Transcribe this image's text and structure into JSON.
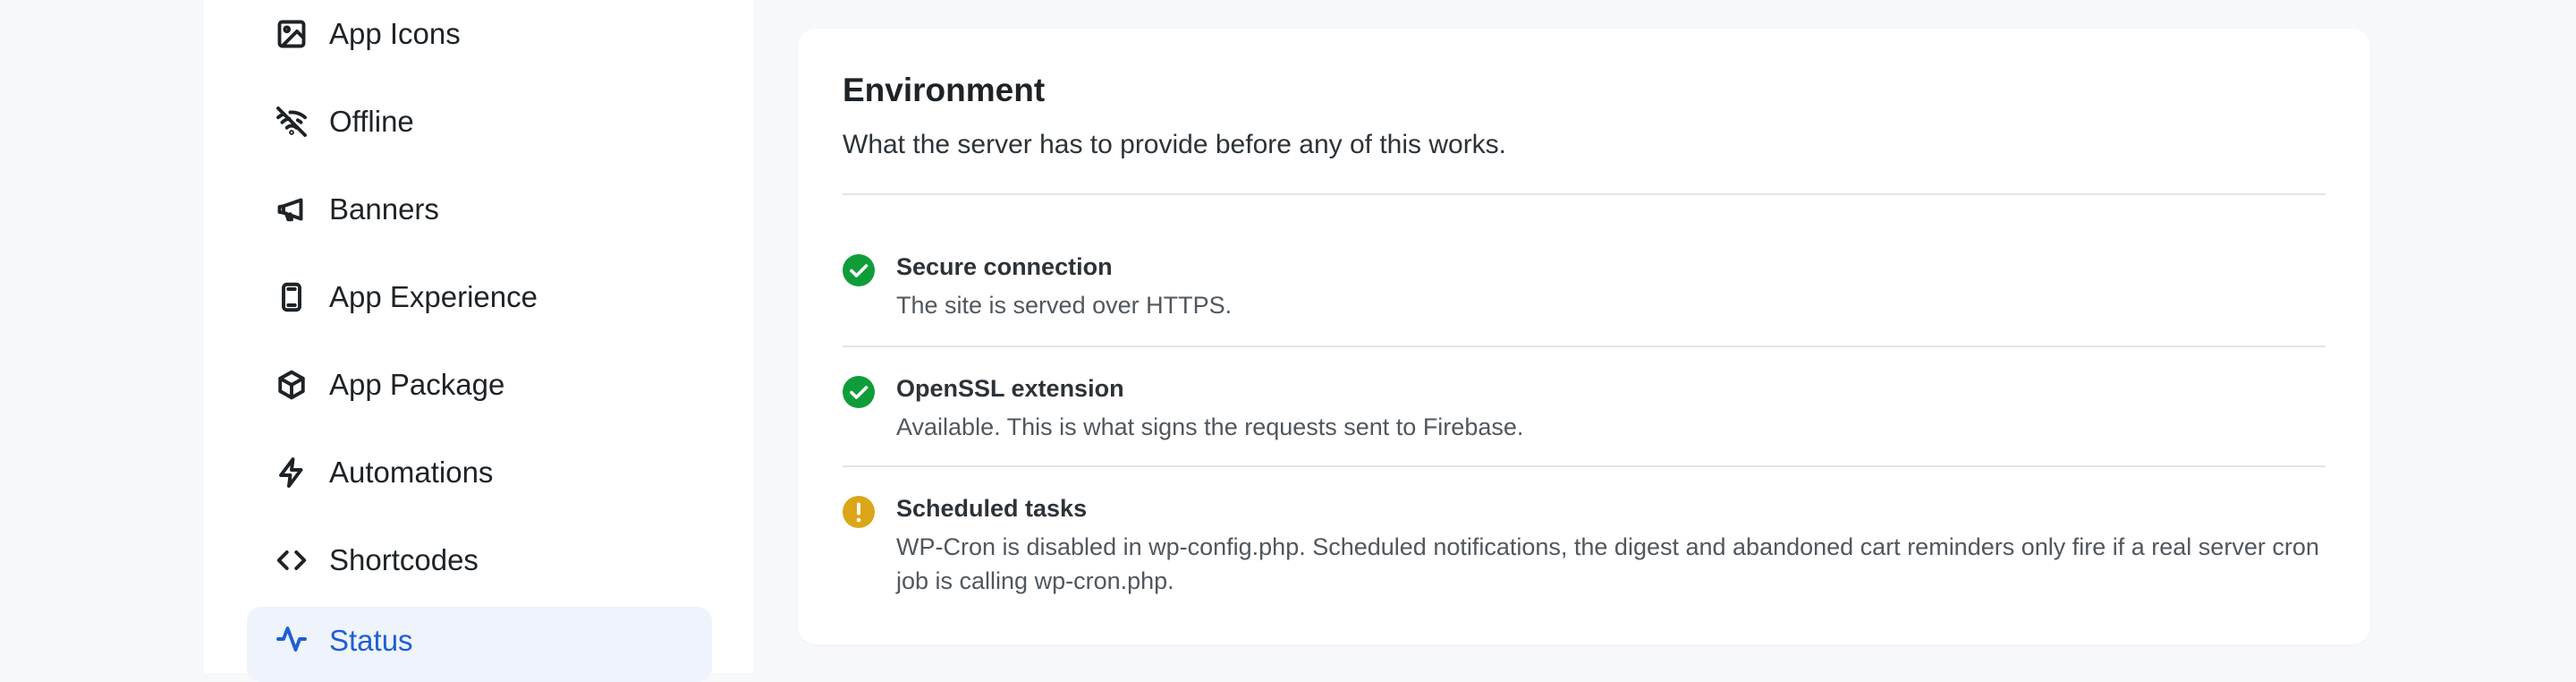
{
  "sidebar": {
    "items": [
      {
        "label": "App Icons",
        "icon": "image-icon"
      },
      {
        "label": "Offline",
        "icon": "wifi-off-icon"
      },
      {
        "label": "Banners",
        "icon": "megaphone-icon"
      },
      {
        "label": "App Experience",
        "icon": "phone-icon"
      },
      {
        "label": "App Package",
        "icon": "package-icon"
      },
      {
        "label": "Automations",
        "icon": "lightning-icon"
      },
      {
        "label": "Shortcodes",
        "icon": "code-icon"
      },
      {
        "label": "Status",
        "icon": "activity-icon",
        "active": true
      }
    ]
  },
  "environment": {
    "title": "Environment",
    "subtitle": "What the server has to provide before any of this works.",
    "checks": [
      {
        "title": "Secure connection",
        "description": "The site is served over HTTPS.",
        "status": "ok",
        "icon": "check-circle-icon"
      },
      {
        "title": "OpenSSL extension",
        "description": "Available. This is what signs the requests sent to Firebase.",
        "status": "ok",
        "icon": "check-circle-icon"
      },
      {
        "title": "Scheduled tasks",
        "description": "WP-Cron is disabled in wp-config.php. Scheduled notifications, the digest and abandoned cart reminders only fire if a real server cron job is calling wp-cron.php.",
        "status": "warning",
        "icon": "warning-circle-icon"
      }
    ]
  },
  "colors": {
    "ok": "#0f9d3a",
    "warning": "#dba617",
    "accent": "#1f5fd1",
    "active_bg": "#eef3fc"
  }
}
